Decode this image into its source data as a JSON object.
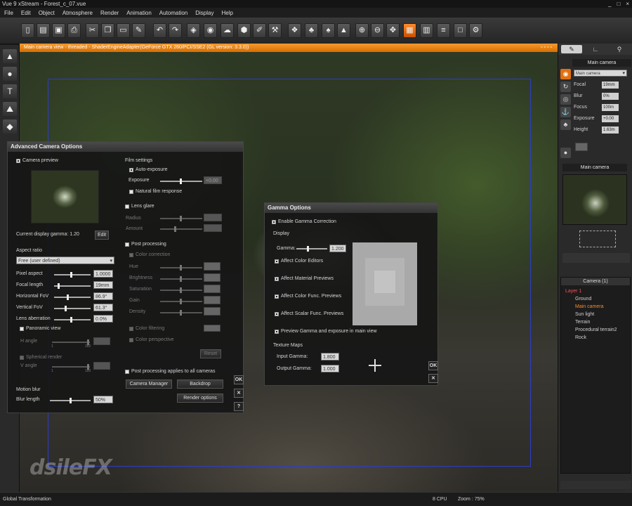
{
  "window": {
    "title": "Vue 9 xStream - Forest_c_07.vue",
    "controls": [
      "_",
      "□",
      "×"
    ]
  },
  "menu": [
    "File",
    "Edit",
    "Object",
    "Atmosphere",
    "Render",
    "Animation",
    "Automation",
    "Display",
    "Help"
  ],
  "toolbar": [
    {
      "icon": "new-doc-icon",
      "glyph": "▯"
    },
    {
      "icon": "open-folder-icon",
      "glyph": "▤"
    },
    {
      "icon": "save-icon",
      "glyph": "▣"
    },
    {
      "icon": "print-icon",
      "glyph": "⎙"
    },
    {
      "icon": "cut-icon",
      "glyph": "✂"
    },
    {
      "icon": "copy-icon",
      "glyph": "❐"
    },
    {
      "icon": "paste-icon",
      "glyph": "▭"
    },
    {
      "icon": "edit-icon",
      "glyph": "✎"
    },
    {
      "icon": "undo-icon",
      "glyph": "↶"
    },
    {
      "icon": "redo-icon",
      "glyph": "↷"
    },
    {
      "icon": "object-icon",
      "glyph": "◈"
    },
    {
      "icon": "material-icon",
      "glyph": "◉"
    },
    {
      "icon": "cloud-icon",
      "glyph": "☁"
    },
    {
      "icon": "box-icon",
      "glyph": "⬢"
    },
    {
      "icon": "brush-icon",
      "glyph": "✐"
    },
    {
      "icon": "tool-icon",
      "glyph": "⚒"
    },
    {
      "icon": "palette-icon",
      "glyph": "❖"
    },
    {
      "icon": "plant-icon",
      "glyph": "♣"
    },
    {
      "icon": "ecosystem-icon",
      "glyph": "♠"
    },
    {
      "icon": "rocks-icon",
      "glyph": "▲"
    },
    {
      "icon": "zoom-in-icon",
      "glyph": "⊕"
    },
    {
      "icon": "zoom-out-icon",
      "glyph": "⊖"
    },
    {
      "icon": "pan-icon",
      "glyph": "✥"
    },
    {
      "icon": "camera-view-icon",
      "glyph": "▦",
      "active": true
    },
    {
      "icon": "render-area-icon",
      "glyph": "▥"
    },
    {
      "icon": "layers-icon",
      "glyph": "≡"
    },
    {
      "icon": "frame-icon",
      "glyph": "□"
    },
    {
      "icon": "gear-render-icon",
      "glyph": "⚙"
    }
  ],
  "lefttools": [
    {
      "icon": "terrain-tool-icon",
      "glyph": "▲"
    },
    {
      "icon": "sphere-tool-icon",
      "glyph": "●"
    },
    {
      "icon": "text-tool-icon",
      "glyph": "T"
    },
    {
      "icon": "mountain-tool-icon",
      "glyph": "⛰"
    },
    {
      "icon": "rocks-tool-icon",
      "glyph": "◆"
    }
  ],
  "viewport": {
    "header": "Main camera view - threaded - ShaderEngineAdapter(GeForce GTX 260/PCI/SSE2 (GL version: 3.3.0))",
    "controls": "▫▫▫▫"
  },
  "watermark": "dsileFX",
  "camera_dialog": {
    "title": "Advanced Camera Options",
    "camera_preview": "Camera preview",
    "gamma_label": "Current display gamma: 1.20",
    "gamma_edit": "Edit",
    "aspect_ratio": "Aspect ratio",
    "aspect_select": "Free (user defined)",
    "rows": [
      {
        "label": "Pixel aspect",
        "value": "1.0000",
        "pos": 0.45
      },
      {
        "label": "Focal length",
        "value": "19mm",
        "pos": 0.1
      },
      {
        "label": "Horizontal FoV",
        "value": "86.9°",
        "pos": 0.35
      },
      {
        "label": "Vertical FoV",
        "value": "61.3°",
        "pos": 0.3
      },
      {
        "label": "Lens aberration",
        "value": "0.0%",
        "pos": 0.45
      }
    ],
    "panoramic_view": "Panoramic view",
    "h_angle": "H angle",
    "spherical_render": "Spherical render",
    "v_angle": "V angle",
    "tick_1": "1",
    "tick_360": "360",
    "tick_180": "180",
    "motion_blur": "Motion blur",
    "blur_length": "Blur length",
    "blur_value": "50%",
    "film_settings": "Film settings",
    "auto_exposure": "Auto-exposure",
    "exposure": "Exposure",
    "exposure_value": "+0.00",
    "natural_film": "Natural film response",
    "lens_glare": "Lens glare",
    "radius": "Radius",
    "amount": "Amount",
    "post_processing": "Post processing",
    "color_correction": "Color correction",
    "pp_rows": [
      "Hue",
      "Brightness",
      "Saturation",
      "Gain",
      "Density"
    ],
    "color_filtering": "Color filtering",
    "color_perspective": "Color perspective",
    "reset": "Reset",
    "pp_all": "Post processing applies to all cameras",
    "camera_manager": "Camera Manager",
    "backdrop": "Backdrop",
    "render_options": "Render options",
    "ok": "OK",
    "cancel": "✕",
    "help": "?"
  },
  "gamma_dialog": {
    "title": "Gamma Options",
    "enable": "Enable Gamma Correction",
    "display": "Display",
    "gamma_label": "Gamma:",
    "gamma_value": "1.200",
    "checks": [
      "Affect Color Editors",
      "Affect Material Previews",
      "Affect Color Func. Previews",
      "Affect Scalar Func. Previews",
      "Preview Gamma and exposure in main view"
    ],
    "texture_maps": "Texture Maps",
    "input_gamma": "Input Gamma:",
    "input_value": "1.800",
    "output_gamma": "Output Gamma:",
    "output_value": "1.000",
    "ok": "OK",
    "cancel": "✕"
  },
  "right_panel": {
    "tabs": [
      "✎",
      "∟",
      "⚲"
    ],
    "title": "Main camera",
    "select": "Main camera",
    "props": [
      {
        "label": "Focal",
        "value": "19mm"
      },
      {
        "label": "Blur",
        "value": "0%"
      },
      {
        "label": "Focus",
        "value": "100m"
      },
      {
        "label": "Exposure",
        "value": "+0.00"
      },
      {
        "label": "Height",
        "value": "1.63m"
      }
    ],
    "preview_title": "Main camera",
    "tree_title": "Camera (1)",
    "tree": [
      {
        "label": "Layer 1",
        "kind": "layer",
        "indent": 0
      },
      {
        "label": "Ground",
        "kind": "",
        "indent": 1
      },
      {
        "label": "Main camera",
        "kind": "sel",
        "indent": 1
      },
      {
        "label": "Sun light",
        "kind": "",
        "indent": 1
      },
      {
        "label": "Terrain",
        "kind": "",
        "indent": 1
      },
      {
        "label": "Procedural terrain2",
        "kind": "",
        "indent": 1
      },
      {
        "label": "Rock",
        "kind": "",
        "indent": 1
      }
    ]
  },
  "statusbar": {
    "left": "Global Transformation",
    "cpu": "8 CPU",
    "zoom": "Zoom : 75%"
  }
}
